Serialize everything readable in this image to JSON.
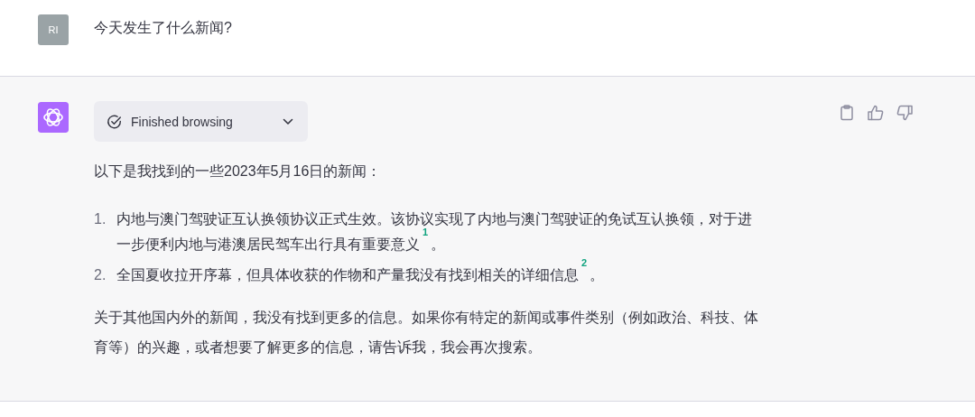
{
  "user_message": {
    "avatar_initials": "RI",
    "text": "今天发生了什么新闻?"
  },
  "assistant_message": {
    "status": {
      "kind": "finished",
      "label": "Finished browsing"
    },
    "intro": "以下是我找到的一些2023年5月16日的新闻：",
    "items": [
      {
        "number": "1.",
        "text": "内地与澳门驾驶证互认换领协议正式生效。该协议实现了内地与澳门驾驶证的免试互认换领，对于进一步便利内地与港澳居民驾车出行具有重要意义",
        "citation": "1",
        "after": "。"
      },
      {
        "number": "2.",
        "text": "全国夏收拉开序幕，但具体收获的作物和产量我没有找到相关的详细信息",
        "citation": "2",
        "after": "。"
      }
    ],
    "outro": "关于其他国内外的新闻，我没有找到更多的信息。如果你有特定的新闻或事件类别（例如政治、科技、体育等）的兴趣，或者想要了解更多的信息，请告诉我，我会再次搜索。"
  }
}
